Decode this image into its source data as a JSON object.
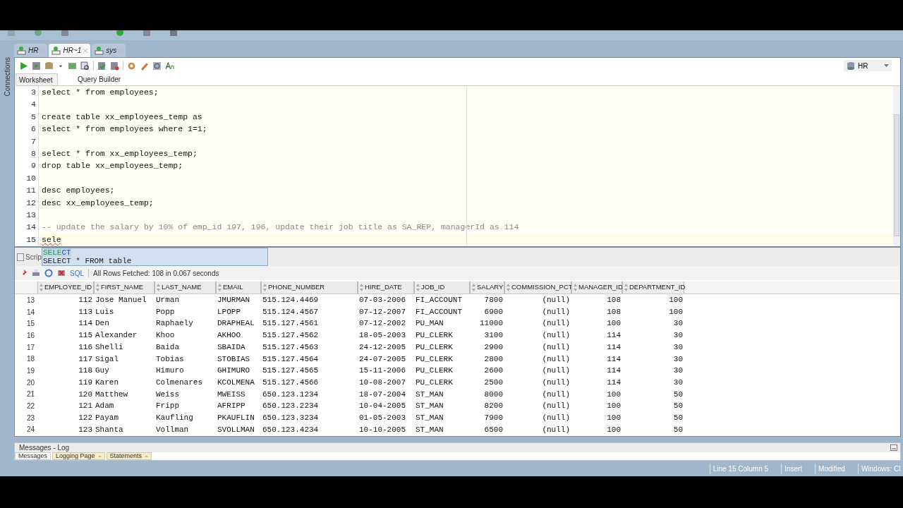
{
  "connection_tabs": [
    {
      "label": "HR",
      "selected": false
    },
    {
      "label": "HR~1",
      "selected": true
    },
    {
      "label": "sys",
      "selected": false
    }
  ],
  "side_panel": {
    "label": "Connections"
  },
  "connection_selector": {
    "value": "HR"
  },
  "editor_tabs": [
    {
      "label": "Worksheet",
      "selected": true
    },
    {
      "label": "Query Builder",
      "selected": false
    }
  ],
  "code_lines": [
    {
      "number": "3",
      "text": "select * from employees;",
      "kind": "code"
    },
    {
      "number": "4",
      "kind": "blank"
    },
    {
      "number": "5",
      "text": "create table xx_employees_temp as",
      "kind": "code"
    },
    {
      "number": "6",
      "text": "select * from employees where 1=1;",
      "kind": "code"
    },
    {
      "number": "7",
      "kind": "blank"
    },
    {
      "number": "8",
      "text": "select * from xx_employees_temp;",
      "kind": "code"
    },
    {
      "number": "9",
      "text": "drop table xx_employees_temp;",
      "kind": "code"
    },
    {
      "number": "10",
      "kind": "blank"
    },
    {
      "number": "11",
      "text": "desc employees;",
      "kind": "code"
    },
    {
      "number": "12",
      "text": "desc xx_employees_temp;",
      "kind": "code"
    },
    {
      "number": "13",
      "kind": "blank"
    },
    {
      "number": "14",
      "text": "-- update the salary by 10% of emp_id 197, 196, update their job title as SA_REP, managerId as 114",
      "kind": "comment"
    },
    {
      "number": "15",
      "text": "sele",
      "kind": "current"
    }
  ],
  "autocomplete": [
    {
      "typed": "SELE",
      "rest": "CT",
      "selected": true
    },
    {
      "rest": "SELECT * FROM table",
      "selected": false
    }
  ],
  "results_tab": {
    "label": "Scrip"
  },
  "results_toolbar": {
    "sql_label": "SQL",
    "status": "All Rows Fetched: 108 in 0.067 seconds"
  },
  "table": {
    "columns": [
      "EMPLOYEE_ID",
      "FIRST_NAME",
      "LAST_NAME",
      "EMAIL",
      "PHONE_NUMBER",
      "HIRE_DATE",
      "JOB_ID",
      "SALARY",
      "COMMISSION_PCT",
      "MANAGER_ID",
      "DEPARTMENT_ID"
    ],
    "rows": [
      {
        "number": "13",
        "cells": [
          "112",
          "Jose Manuel",
          "Urman",
          "JMURMAN",
          "515.124.4469",
          "07-03-2006",
          "FI_ACCOUNT",
          "7800",
          "(null)",
          "108",
          "100"
        ]
      },
      {
        "number": "14",
        "cells": [
          "113",
          "Luis",
          "Popp",
          "LPOPP",
          "515.124.4567",
          "07-12-2007",
          "FI_ACCOUNT",
          "6900",
          "(null)",
          "108",
          "100"
        ]
      },
      {
        "number": "15",
        "cells": [
          "114",
          "Den",
          "Raphaely",
          "DRAPHEAL",
          "515.127.4561",
          "07-12-2002",
          "PU_MAN",
          "11000",
          "(null)",
          "100",
          "30"
        ]
      },
      {
        "number": "16",
        "cells": [
          "115",
          "Alexander",
          "Khoo",
          "AKHOO",
          "515.127.4562",
          "18-05-2003",
          "PU_CLERK",
          "3100",
          "(null)",
          "114",
          "30"
        ]
      },
      {
        "number": "17",
        "cells": [
          "116",
          "Shelli",
          "Baida",
          "SBAIDA",
          "515.127.4563",
          "24-12-2005",
          "PU_CLERK",
          "2900",
          "(null)",
          "114",
          "30"
        ]
      },
      {
        "number": "18",
        "cells": [
          "117",
          "Sigal",
          "Tobias",
          "STOBIAS",
          "515.127.4564",
          "24-07-2005",
          "PU_CLERK",
          "2800",
          "(null)",
          "114",
          "30"
        ]
      },
      {
        "number": "19",
        "cells": [
          "118",
          "Guy",
          "Himuro",
          "GHIMURO",
          "515.127.4565",
          "15-11-2006",
          "PU_CLERK",
          "2600",
          "(null)",
          "114",
          "30"
        ]
      },
      {
        "number": "20",
        "cells": [
          "119",
          "Karen",
          "Colmenares",
          "KCOLMENA",
          "515.127.4566",
          "10-08-2007",
          "PU_CLERK",
          "2500",
          "(null)",
          "114",
          "30"
        ]
      },
      {
        "number": "21",
        "cells": [
          "120",
          "Matthew",
          "Weiss",
          "MWEISS",
          "650.123.1234",
          "18-07-2004",
          "ST_MAN",
          "8000",
          "(null)",
          "100",
          "50"
        ]
      },
      {
        "number": "22",
        "cells": [
          "121",
          "Adam",
          "Fripp",
          "AFRIPP",
          "650.123.2234",
          "10-04-2005",
          "ST_MAN",
          "8200",
          "(null)",
          "100",
          "50"
        ]
      },
      {
        "number": "23",
        "cells": [
          "122",
          "Payam",
          "Kaufling",
          "PKAUFLIN",
          "650.123.3234",
          "01-05-2003",
          "ST_MAN",
          "7900",
          "(null)",
          "100",
          "50"
        ]
      },
      {
        "number": "24",
        "cells": [
          "123",
          "Shanta",
          "Vollman",
          "SVOLLMAN",
          "650.123.4234",
          "10-10-2005",
          "ST_MAN",
          "6500",
          "(null)",
          "100",
          "50"
        ]
      }
    ]
  },
  "log_panel": {
    "title": "Messages - Log",
    "tabs": [
      {
        "label": "Messages",
        "selected": true
      },
      {
        "label": "Logging Page",
        "selected": false
      },
      {
        "label": "Statements",
        "selected": false
      }
    ]
  },
  "status_bar": [
    "Line 15 Column 5",
    "Insert",
    "Modified",
    "Windows: CI"
  ]
}
